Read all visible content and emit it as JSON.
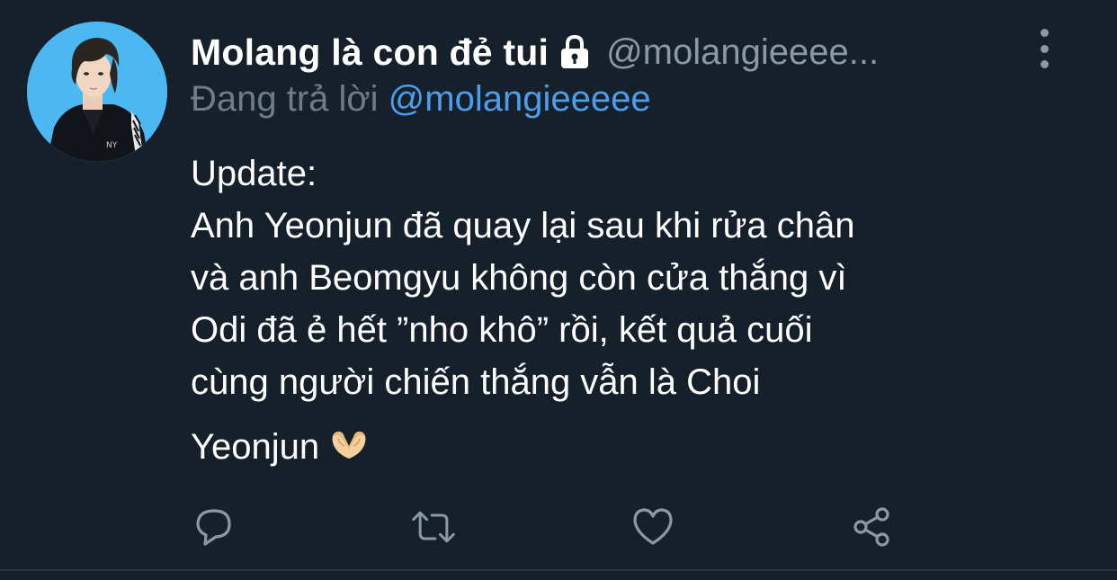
{
  "tweet": {
    "author": {
      "display_name": "Molang là con đẻ tui",
      "handle": "@molangieeee...",
      "protected_icon": "lock-icon"
    },
    "reply_context": {
      "prefix": "Đang trả lời",
      "reply_to": "@molangieeeee"
    },
    "text": {
      "line1": "Update:",
      "line2": "Anh Yeonjun đã quay lại sau khi rửa chân",
      "line3": "và anh Beomgyu không còn cửa thắng vì",
      "line4": "Odi đã ẻ hết ”nho khô” rồi, kết quả cuối",
      "line5": "cùng người chiến thắng vẫn là Choi",
      "line6": "Yeonjun",
      "emoji": "heart-hands-emoji"
    },
    "actions": {
      "reply": "reply-icon",
      "retweet": "retweet-icon",
      "like": "heart-icon",
      "share": "share-icon",
      "more": "more-vertical-icon"
    }
  },
  "colors": {
    "background": "#15202b",
    "text_primary": "#ffffff",
    "text_secondary": "#8b98a5",
    "link": "#4c9eeb",
    "avatar_bg": "#4cb8f2"
  }
}
